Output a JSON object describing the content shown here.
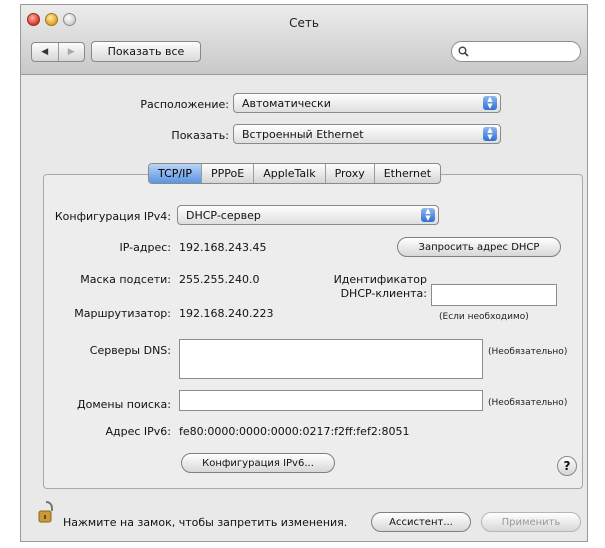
{
  "window": {
    "title": "Сеть"
  },
  "toolbar": {
    "back_icon": "◀",
    "forward_icon": "▶",
    "show_all_label": "Показать все",
    "search_icon": "🔍",
    "search_value": ""
  },
  "location": {
    "label": "Расположение:",
    "value": "Автоматически"
  },
  "show": {
    "label": "Показать:",
    "value": "Встроенный Ethernet"
  },
  "tabs": [
    "TCP/IP",
    "PPPoE",
    "AppleTalk",
    "Proxy",
    "Ethernet"
  ],
  "active_tab": "TCP/IP",
  "tcpip": {
    "ipv4_config_label": "Конфигурация IPv4:",
    "ipv4_config_value": "DHCP-сервер",
    "ip_label": "IP-адрес:",
    "ip_value": "192.168.243.45",
    "renew_dhcp_label": "Запросить адрес DHCP",
    "subnet_label": "Маска подсети:",
    "subnet_value": "255.255.240.0",
    "client_id_label_line1": "Идентификатор",
    "client_id_label_line2": "DHCP-клиента:",
    "client_id_value": "",
    "client_id_hint": "(Если необходимо)",
    "router_label": "Маршрутизатор:",
    "router_value": "192.168.240.223",
    "dns_label": "Серверы DNS:",
    "dns_value": "",
    "dns_hint": "(Необязательно)",
    "search_domains_label": "Домены поиска:",
    "search_domains_value": "",
    "search_domains_hint": "(Необязательно)",
    "ipv6_label": "Адрес IPv6:",
    "ipv6_value": "fe80:0000:0000:0000:0217:f2ff:fef2:8051",
    "configure_ipv6_label": "Конфигурация IPv6...",
    "help_label": "?"
  },
  "footer": {
    "lock_text": "Нажмите на замок, чтобы запретить изменения.",
    "assist_label": "Ассистент...",
    "apply_label": "Применить"
  },
  "colors": {
    "accent": "#5c95e3",
    "window_bg": "#e9e9e9"
  }
}
